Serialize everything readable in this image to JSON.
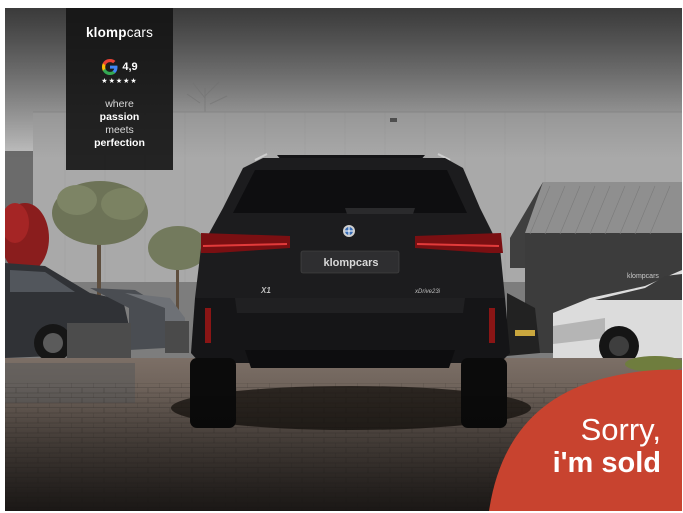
{
  "badge": {
    "brand_bold": "klomp",
    "brand_light": "cars",
    "google_icon": "google-g-icon",
    "rating": "4,9",
    "stars": "★★★★★",
    "tagline": [
      "where",
      "passion",
      "meets",
      "perfection"
    ]
  },
  "car": {
    "plate_text": "klompcars",
    "model_badge": "X1",
    "variant_badge": "xDrive23i"
  },
  "building_sign": "klompcars",
  "sold_banner": {
    "line1": "Sorry,",
    "line2": "i'm sold"
  },
  "colors": {
    "sold_red": "#c8432f",
    "badge_bg": "#141414",
    "car_body": "#1c1c1e"
  }
}
